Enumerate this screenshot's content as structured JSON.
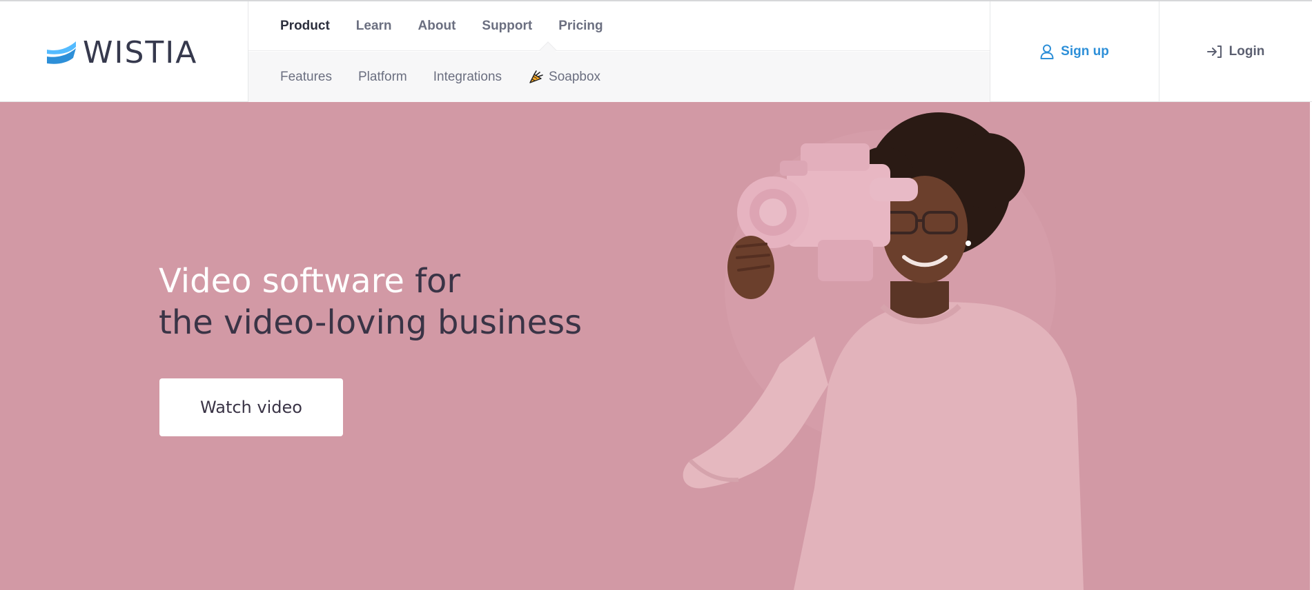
{
  "brand": {
    "name": "WISTIA",
    "accent_color": "#2d8fd8",
    "hero_bg": "#d299a5"
  },
  "nav": {
    "primary": [
      {
        "label": "Product",
        "active": true
      },
      {
        "label": "Learn"
      },
      {
        "label": "About"
      },
      {
        "label": "Support"
      },
      {
        "label": "Pricing"
      }
    ],
    "secondary": [
      {
        "label": "Features"
      },
      {
        "label": "Platform"
      },
      {
        "label": "Integrations"
      },
      {
        "label": "Soapbox",
        "icon": "carrot-megaphone-icon"
      }
    ]
  },
  "auth": {
    "signup": {
      "label": "Sign up",
      "icon": "user-icon"
    },
    "login": {
      "label": "Login",
      "icon": "login-arrow-icon"
    }
  },
  "hero": {
    "headline_highlight": "Video software",
    "headline_rest_line1": " for",
    "headline_line2": "the video-loving business",
    "cta_label": "Watch video"
  }
}
